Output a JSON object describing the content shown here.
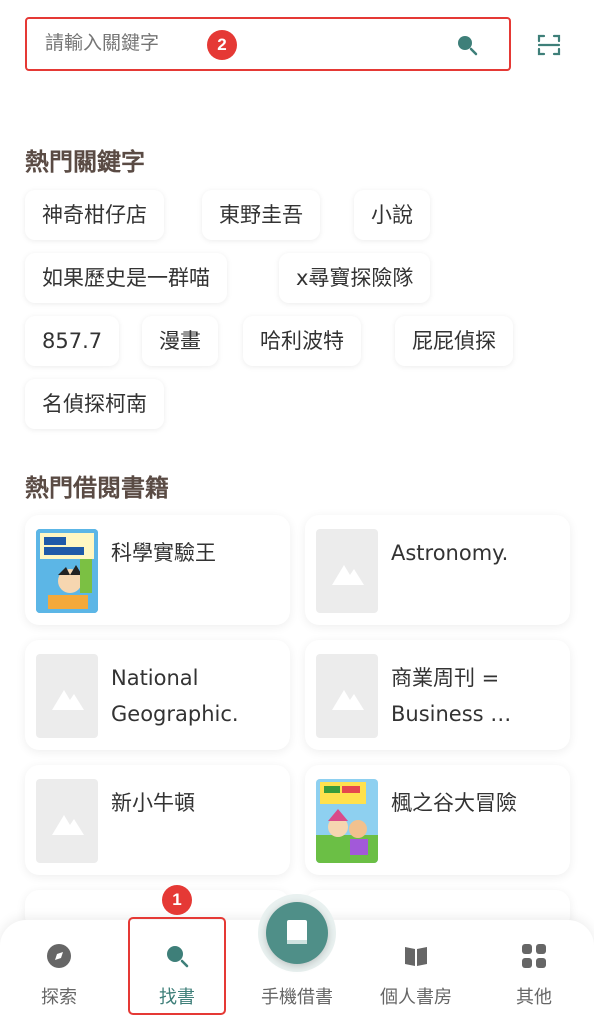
{
  "search": {
    "placeholder": "請輸入關鍵字",
    "annotation_badge": "2"
  },
  "sections": {
    "hot_keywords_title": "熱門關鍵字",
    "hot_books_title": "熱門借閱書籍"
  },
  "keywords": [
    "神奇柑仔店",
    "東野圭吾",
    "小說",
    "如果歷史是一群喵",
    "x尋寶探險隊",
    "857.7",
    "漫畫",
    "哈利波特",
    "屁屁偵探",
    "名偵探柯南"
  ],
  "books": [
    {
      "title": "科學實驗王",
      "cover": "cover-image"
    },
    {
      "title": "Astronomy.",
      "cover": "placeholder"
    },
    {
      "title": "National Geographic.",
      "cover": "placeholder"
    },
    {
      "title": "商業周刊 = Business …",
      "cover": "placeholder"
    },
    {
      "title": "新小牛頓",
      "cover": "placeholder"
    },
    {
      "title": "楓之谷大冒險",
      "cover": "cover-image"
    }
  ],
  "nav": {
    "items": [
      {
        "label": "探索",
        "icon": "compass-icon"
      },
      {
        "label": "找書",
        "icon": "search-icon"
      },
      {
        "label": "手機借書",
        "icon": "book-icon"
      },
      {
        "label": "個人書房",
        "icon": "open-book-icon"
      },
      {
        "label": "其他",
        "icon": "grid-icon"
      }
    ],
    "annotation_badge": "1"
  },
  "colors": {
    "accent": "#3e7f79",
    "annotation": "#e53935",
    "title": "#5a4b44"
  }
}
